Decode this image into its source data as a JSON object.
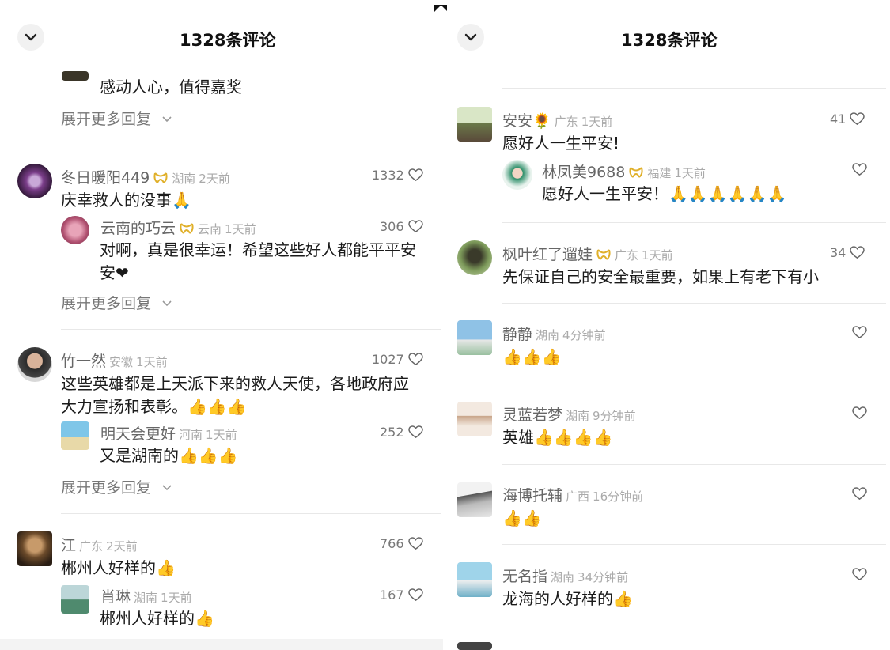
{
  "left": {
    "title": "1328条评论",
    "partial_text": "感动人心，值得嘉奖",
    "expand_1": "展开更多回复",
    "c1": {
      "name": "冬日暖阳449",
      "loc": "湖南",
      "time": "2天前",
      "likes": "1332",
      "text": "庆幸救人的没事🙏"
    },
    "c1r": {
      "name": "云南的巧云",
      "loc": "云南",
      "time": "1天前",
      "likes": "306",
      "text1": "对啊，真是很幸运！希望这些好人都能平平安",
      "text2": "安❤"
    },
    "expand_2": "展开更多回复",
    "c2": {
      "name": "竹一然",
      "loc": "安徽",
      "time": "1天前",
      "likes": "1027",
      "text1": "这些英雄都是上天派下来的救人天使，各地政府应",
      "text2": "大力宣扬和表彰。👍👍👍"
    },
    "c2r": {
      "name": "明天会更好",
      "loc": "河南",
      "time": "1天前",
      "likes": "252",
      "text": "又是湖南的👍👍👍"
    },
    "expand_3": "展开更多回复",
    "c3": {
      "name": "江",
      "loc": "广东",
      "time": "2天前",
      "likes": "766",
      "text": "郴州人好样的👍"
    },
    "c3r": {
      "name": "肖琳",
      "loc": "湖南",
      "time": "1天前",
      "likes": "167",
      "text": "郴州人好样的👍"
    }
  },
  "right": {
    "title": "1328条评论",
    "c1": {
      "name": "安安🌻",
      "loc": "广东",
      "time": "1天前",
      "likes": "41",
      "text": "愿好人一生平安!"
    },
    "c1r": {
      "name": "林凤美9688",
      "loc": "福建",
      "time": "1天前",
      "text": "愿好人一生平安！🙏🙏🙏🙏🙏🙏"
    },
    "c2": {
      "name": "枫叶红了遛娃",
      "loc": "广东",
      "time": "1天前",
      "likes": "34",
      "text": "先保证自己的安全最重要，如果上有老下有小"
    },
    "c3": {
      "name": "静静",
      "loc": "湖南",
      "time": "4分钟前",
      "text": "👍👍👍"
    },
    "c4": {
      "name": "灵蓝若梦",
      "loc": "湖南",
      "time": "9分钟前",
      "text": "英雄👍👍👍👍"
    },
    "c5": {
      "name": "海博托辅",
      "loc": "广西",
      "time": "16分钟前",
      "text": "👍👍"
    },
    "c6": {
      "name": "无名指",
      "loc": "湖南",
      "time": "34分钟前",
      "text": "龙海的人好样的👍"
    }
  },
  "icons": {
    "back": "chevron-down-icon",
    "like": "heart-outline-icon",
    "badge": "yellow-ribbon-badge-icon",
    "expand": "chevron-down-small-icon"
  },
  "colors": {
    "text": "#1a1a1a",
    "meta": "#666666",
    "location": "#aaaaaa",
    "badge": "#e0b02a",
    "divider": "#e8e8e8"
  }
}
